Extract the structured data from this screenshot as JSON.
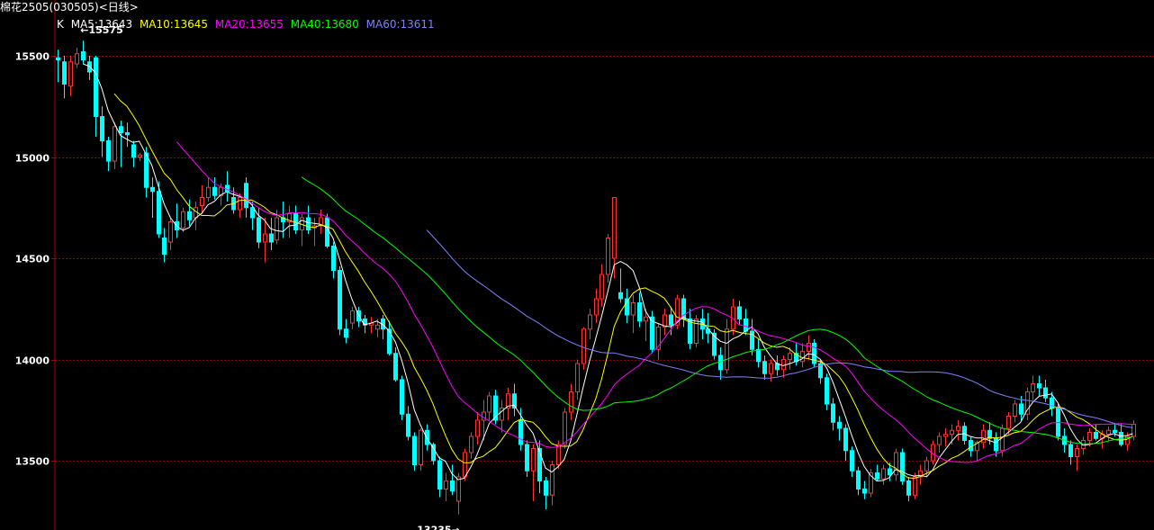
{
  "header": {
    "title": "棉花2505(030505)<日线>"
  },
  "legend": {
    "k_label": "K",
    "items": [
      {
        "label": "MA5:13643",
        "color": "#ffffff"
      },
      {
        "label": "MA10:13645",
        "color": "#ffff00"
      },
      {
        "label": "MA20:13655",
        "color": "#ff00ff"
      },
      {
        "label": "MA40:13680",
        "color": "#00ff00"
      },
      {
        "label": "MA60:13611",
        "color": "#8080ff"
      }
    ]
  },
  "annotations": {
    "high_label": "15575",
    "low_label": "13235"
  },
  "colors": {
    "up": "#ff3232",
    "down": "#00ffff",
    "grid": "#8b0000",
    "axis": "#b00000",
    "text": "#ffffff"
  },
  "chart_data": {
    "type": "candlestick",
    "title": "棉花2505(030505)<日线>",
    "y_ticks": [
      13500,
      14000,
      14500,
      15000,
      15500
    ],
    "ylim": [
      13150,
      15770
    ],
    "grid": true,
    "high": 15575,
    "low": 13235,
    "ohlc": [
      [
        15490,
        15530,
        15370,
        15480
      ],
      [
        15470,
        15500,
        15290,
        15360
      ],
      [
        15350,
        15500,
        15300,
        15470
      ],
      [
        15460,
        15540,
        15440,
        15510
      ],
      [
        15520,
        15575,
        15460,
        15480
      ],
      [
        15470,
        15500,
        15380,
        15420
      ],
      [
        15490,
        15500,
        15100,
        15200
      ],
      [
        15200,
        15250,
        15000,
        15080
      ],
      [
        15080,
        15100,
        14930,
        14980
      ],
      [
        14980,
        15170,
        14940,
        15150
      ],
      [
        15150,
        15180,
        14950,
        15120
      ],
      [
        15120,
        15170,
        15050,
        15110
      ],
      [
        15060,
        15080,
        14950,
        15000
      ],
      [
        15000,
        15020,
        14980,
        15010
      ],
      [
        15020,
        15050,
        14800,
        14850
      ],
      [
        14850,
        14900,
        14700,
        14830
      ],
      [
        14830,
        14880,
        14600,
        14620
      ],
      [
        14600,
        14650,
        14480,
        14520
      ],
      [
        14580,
        14700,
        14540,
        14680
      ],
      [
        14680,
        14770,
        14600,
        14640
      ],
      [
        14650,
        14750,
        14630,
        14730
      ],
      [
        14730,
        14790,
        14660,
        14690
      ],
      [
        14700,
        14780,
        14640,
        14750
      ],
      [
        14760,
        14860,
        14720,
        14800
      ],
      [
        14800,
        14900,
        14780,
        14850
      ],
      [
        14850,
        14900,
        14790,
        14810
      ],
      [
        14810,
        14870,
        14760,
        14850
      ],
      [
        14860,
        14930,
        14780,
        14830
      ],
      [
        14800,
        14850,
        14720,
        14740
      ],
      [
        14740,
        14820,
        14700,
        14800
      ],
      [
        14870,
        14900,
        14700,
        14750
      ],
      [
        14750,
        14780,
        14640,
        14700
      ],
      [
        14700,
        14750,
        14550,
        14580
      ],
      [
        14580,
        14700,
        14480,
        14620
      ],
      [
        14620,
        14700,
        14540,
        14580
      ],
      [
        14590,
        14740,
        14570,
        14700
      ],
      [
        14700,
        14780,
        14600,
        14680
      ],
      [
        14680,
        14760,
        14600,
        14720
      ],
      [
        14720,
        14760,
        14620,
        14640
      ],
      [
        14640,
        14720,
        14560,
        14700
      ],
      [
        14700,
        14760,
        14620,
        14640
      ],
      [
        14650,
        14700,
        14560,
        14660
      ],
      [
        14660,
        14740,
        14620,
        14700
      ],
      [
        14700,
        14720,
        14550,
        14560
      ],
      [
        14560,
        14580,
        14400,
        14440
      ],
      [
        14440,
        14460,
        14120,
        14150
      ],
      [
        14150,
        14200,
        14080,
        14110
      ],
      [
        14180,
        14260,
        14150,
        14240
      ],
      [
        14240,
        14260,
        14160,
        14190
      ],
      [
        14200,
        14220,
        14130,
        14170
      ],
      [
        14170,
        14210,
        14130,
        14180
      ],
      [
        14150,
        14200,
        14110,
        14170
      ],
      [
        14200,
        14220,
        14100,
        14150
      ],
      [
        14150,
        14190,
        14020,
        14030
      ],
      [
        14030,
        14060,
        13890,
        13900
      ],
      [
        13900,
        13920,
        13700,
        13730
      ],
      [
        13730,
        13770,
        13600,
        13620
      ],
      [
        13620,
        13640,
        13450,
        13480
      ],
      [
        13480,
        13660,
        13450,
        13650
      ],
      [
        13650,
        13680,
        13550,
        13580
      ],
      [
        13580,
        13590,
        13480,
        13500
      ],
      [
        13500,
        13520,
        13320,
        13360
      ],
      [
        13360,
        13440,
        13300,
        13400
      ],
      [
        13400,
        13480,
        13330,
        13350
      ],
      [
        13300,
        13440,
        13235,
        13420
      ],
      [
        13420,
        13560,
        13400,
        13540
      ],
      [
        13540,
        13640,
        13510,
        13620
      ],
      [
        13620,
        13740,
        13580,
        13700
      ],
      [
        13700,
        13800,
        13600,
        13740
      ],
      [
        13740,
        13840,
        13700,
        13820
      ],
      [
        13820,
        13850,
        13680,
        13700
      ],
      [
        13700,
        13800,
        13640,
        13760
      ],
      [
        13760,
        13860,
        13700,
        13830
      ],
      [
        13830,
        13880,
        13720,
        13760
      ],
      [
        13700,
        13760,
        13550,
        13580
      ],
      [
        13580,
        13600,
        13420,
        13450
      ],
      [
        13450,
        13580,
        13300,
        13560
      ],
      [
        13560,
        13600,
        13340,
        13400
      ],
      [
        13400,
        13420,
        13260,
        13330
      ],
      [
        13330,
        13500,
        13280,
        13480
      ],
      [
        13480,
        13600,
        13460,
        13580
      ],
      [
        13580,
        13760,
        13560,
        13740
      ],
      [
        13740,
        13880,
        13700,
        13840
      ],
      [
        13840,
        14000,
        13800,
        13980
      ],
      [
        13980,
        14160,
        13950,
        14150
      ],
      [
        14150,
        14250,
        14100,
        14220
      ],
      [
        14220,
        14350,
        14180,
        14300
      ],
      [
        14300,
        14470,
        14260,
        14420
      ],
      [
        14420,
        14620,
        14380,
        14600
      ],
      [
        14500,
        14800,
        14400,
        14800
      ],
      [
        14330,
        14450,
        14280,
        14300
      ],
      [
        14300,
        14350,
        14180,
        14220
      ],
      [
        14220,
        14320,
        14130,
        14280
      ],
      [
        14280,
        14330,
        14160,
        14190
      ],
      [
        14190,
        14250,
        14090,
        14210
      ],
      [
        14210,
        14240,
        14030,
        14050
      ],
      [
        14050,
        14180,
        14000,
        14160
      ],
      [
        14160,
        14250,
        14120,
        14220
      ],
      [
        14220,
        14260,
        14120,
        14170
      ],
      [
        14170,
        14320,
        14150,
        14300
      ],
      [
        14300,
        14320,
        14160,
        14200
      ],
      [
        14200,
        14250,
        14050,
        14080
      ],
      [
        14080,
        14220,
        14060,
        14200
      ],
      [
        14200,
        14250,
        14100,
        14150
      ],
      [
        14150,
        14230,
        14080,
        14130
      ],
      [
        14130,
        14150,
        14000,
        14020
      ],
      [
        14020,
        14060,
        13900,
        13950
      ],
      [
        13950,
        14200,
        13930,
        14150
      ],
      [
        14150,
        14300,
        14120,
        14260
      ],
      [
        14260,
        14290,
        14170,
        14200
      ],
      [
        14200,
        14250,
        14120,
        14140
      ],
      [
        14140,
        14200,
        14020,
        14050
      ],
      [
        14050,
        14100,
        13960,
        13990
      ],
      [
        13990,
        14020,
        13900,
        13930
      ],
      [
        13930,
        14000,
        13890,
        13980
      ],
      [
        13980,
        14020,
        13920,
        13950
      ],
      [
        13950,
        14020,
        13910,
        14000
      ],
      [
        14000,
        14060,
        13950,
        14030
      ],
      [
        14030,
        14080,
        13970,
        13990
      ],
      [
        13990,
        14080,
        13960,
        14040
      ],
      [
        14040,
        14120,
        14000,
        14080
      ],
      [
        14080,
        14100,
        13960,
        13980
      ],
      [
        13980,
        14000,
        13880,
        13910
      ],
      [
        13910,
        13930,
        13750,
        13780
      ],
      [
        13780,
        13810,
        13650,
        13690
      ],
      [
        13690,
        13720,
        13600,
        13660
      ],
      [
        13660,
        13680,
        13500,
        13550
      ],
      [
        13550,
        13570,
        13420,
        13450
      ],
      [
        13450,
        13470,
        13330,
        13360
      ],
      [
        13360,
        13400,
        13310,
        13340
      ],
      [
        13340,
        13460,
        13320,
        13440
      ],
      [
        13440,
        13480,
        13400,
        13410
      ],
      [
        13410,
        13480,
        13380,
        13460
      ],
      [
        13460,
        13490,
        13400,
        13430
      ],
      [
        13430,
        13560,
        13400,
        13540
      ],
      [
        13540,
        13560,
        13380,
        13400
      ],
      [
        13400,
        13420,
        13300,
        13330
      ],
      [
        13330,
        13440,
        13310,
        13420
      ],
      [
        13420,
        13480,
        13380,
        13450
      ],
      [
        13450,
        13520,
        13420,
        13500
      ],
      [
        13500,
        13600,
        13480,
        13580
      ],
      [
        13580,
        13640,
        13540,
        13620
      ],
      [
        13620,
        13660,
        13570,
        13630
      ],
      [
        13630,
        13680,
        13580,
        13650
      ],
      [
        13650,
        13700,
        13600,
        13670
      ],
      [
        13670,
        13690,
        13580,
        13600
      ],
      [
        13600,
        13620,
        13520,
        13550
      ],
      [
        13550,
        13600,
        13500,
        13590
      ],
      [
        13590,
        13680,
        13560,
        13650
      ],
      [
        13650,
        13690,
        13580,
        13610
      ],
      [
        13610,
        13640,
        13520,
        13550
      ],
      [
        13550,
        13680,
        13520,
        13660
      ],
      [
        13660,
        13740,
        13630,
        13720
      ],
      [
        13720,
        13800,
        13690,
        13780
      ],
      [
        13780,
        13820,
        13700,
        13730
      ],
      [
        13730,
        13860,
        13700,
        13840
      ],
      [
        13840,
        13920,
        13800,
        13880
      ],
      [
        13880,
        13920,
        13820,
        13860
      ],
      [
        13860,
        13900,
        13790,
        13810
      ],
      [
        13810,
        13840,
        13720,
        13760
      ],
      [
        13760,
        13780,
        13600,
        13620
      ],
      [
        13620,
        13660,
        13540,
        13580
      ],
      [
        13580,
        13600,
        13480,
        13520
      ],
      [
        13520,
        13580,
        13450,
        13560
      ],
      [
        13560,
        13620,
        13530,
        13600
      ],
      [
        13600,
        13660,
        13570,
        13640
      ],
      [
        13640,
        13680,
        13600,
        13610
      ],
      [
        13610,
        13650,
        13560,
        13630
      ],
      [
        13630,
        13670,
        13600,
        13650
      ],
      [
        13650,
        13680,
        13620,
        13640
      ],
      [
        13640,
        13680,
        13570,
        13580
      ],
      [
        13580,
        13640,
        13550,
        13620
      ],
      [
        13620,
        13700,
        13600,
        13680
      ]
    ],
    "series": [
      {
        "name": "MA5",
        "color": "#ffffff",
        "period": 5
      },
      {
        "name": "MA10",
        "color": "#ffff00",
        "period": 10
      },
      {
        "name": "MA20",
        "color": "#ff00ff",
        "period": 20
      },
      {
        "name": "MA40",
        "color": "#00ff00",
        "period": 40
      },
      {
        "name": "MA60",
        "color": "#8080ff",
        "period": 60
      }
    ]
  }
}
